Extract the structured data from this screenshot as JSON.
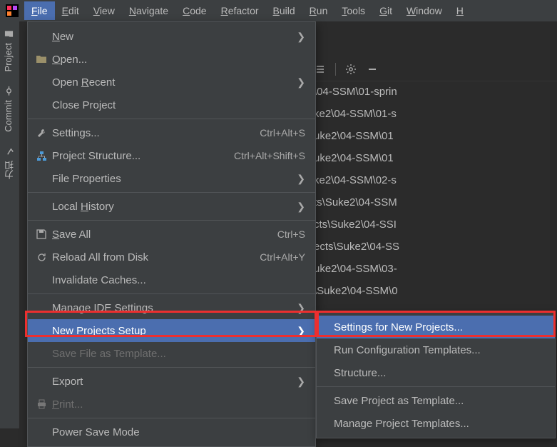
{
  "menubar": [
    "File",
    "Edit",
    "View",
    "Navigate",
    "Code",
    "Refactor",
    "Build",
    "Run",
    "Tools",
    "Git",
    "Window",
    "H"
  ],
  "activeMenu": 0,
  "indicator": "11",
  "rail": [
    "Project",
    "Commit",
    "力扣"
  ],
  "dropdown": [
    {
      "type": "item",
      "label": "New",
      "u": "N",
      "icon": "",
      "sub": true
    },
    {
      "type": "item",
      "label": "Open...",
      "u": "O",
      "icon": "folder"
    },
    {
      "type": "item",
      "label": "Open Recent",
      "u": "R",
      "icon": "",
      "sub": true
    },
    {
      "type": "item",
      "label": "Close Project",
      "u": "",
      "icon": ""
    },
    {
      "type": "sep"
    },
    {
      "type": "item",
      "label": "Settings...",
      "u": "",
      "icon": "wrench",
      "short": "Ctrl+Alt+S"
    },
    {
      "type": "item",
      "label": "Project Structure...",
      "u": "",
      "icon": "struct",
      "short": "Ctrl+Alt+Shift+S"
    },
    {
      "type": "item",
      "label": "File Properties",
      "u": "",
      "icon": "",
      "sub": true
    },
    {
      "type": "sep"
    },
    {
      "type": "item",
      "label": "Local History",
      "u": "H",
      "icon": "",
      "sub": true
    },
    {
      "type": "sep"
    },
    {
      "type": "item",
      "label": "Save All",
      "u": "S",
      "icon": "save",
      "short": "Ctrl+S"
    },
    {
      "type": "item",
      "label": "Reload All from Disk",
      "u": "",
      "icon": "reload",
      "short": "Ctrl+Alt+Y"
    },
    {
      "type": "item",
      "label": "Invalidate Caches...",
      "u": "",
      "icon": ""
    },
    {
      "type": "sep"
    },
    {
      "type": "item",
      "label": "Manage IDE Settings",
      "u": "",
      "icon": "",
      "sub": true
    },
    {
      "type": "item",
      "label": "New Projects Setup",
      "u": "",
      "icon": "",
      "sub": true,
      "sel": true
    },
    {
      "type": "item",
      "label": "Save File as Template...",
      "u": "",
      "icon": "",
      "disabled": true
    },
    {
      "type": "sep"
    },
    {
      "type": "item",
      "label": "Export",
      "u": "",
      "icon": "",
      "sub": true
    },
    {
      "type": "item",
      "label": "Print...",
      "u": "P",
      "icon": "print",
      "disabled": true
    },
    {
      "type": "sep"
    },
    {
      "type": "item",
      "label": "Power Save Mode",
      "u": "",
      "icon": ""
    }
  ],
  "submenu": [
    {
      "label": "Settings for New Projects...",
      "sel": true
    },
    {
      "label": "Run Configuration Templates..."
    },
    {
      "label": "Structure..."
    },
    {
      "type": "sep"
    },
    {
      "label": "Save Project as Template..."
    },
    {
      "label": "Manage Project Templates..."
    }
  ],
  "crumbs": [
    "\\04-SSM\\01-sprin",
    "ke2\\04-SSM\\01-s",
    "uke2\\04-SSM\\01",
    "uke2\\04-SSM\\01",
    "ke2\\04-SSM\\02-s",
    "ts\\Suke2\\04-SSM",
    "cts\\Suke2\\04-SSI",
    "ects\\Suke2\\04-SS",
    "uke2\\04-SSM\\03-",
    "\\Suke2\\04-SSM\\0"
  ]
}
